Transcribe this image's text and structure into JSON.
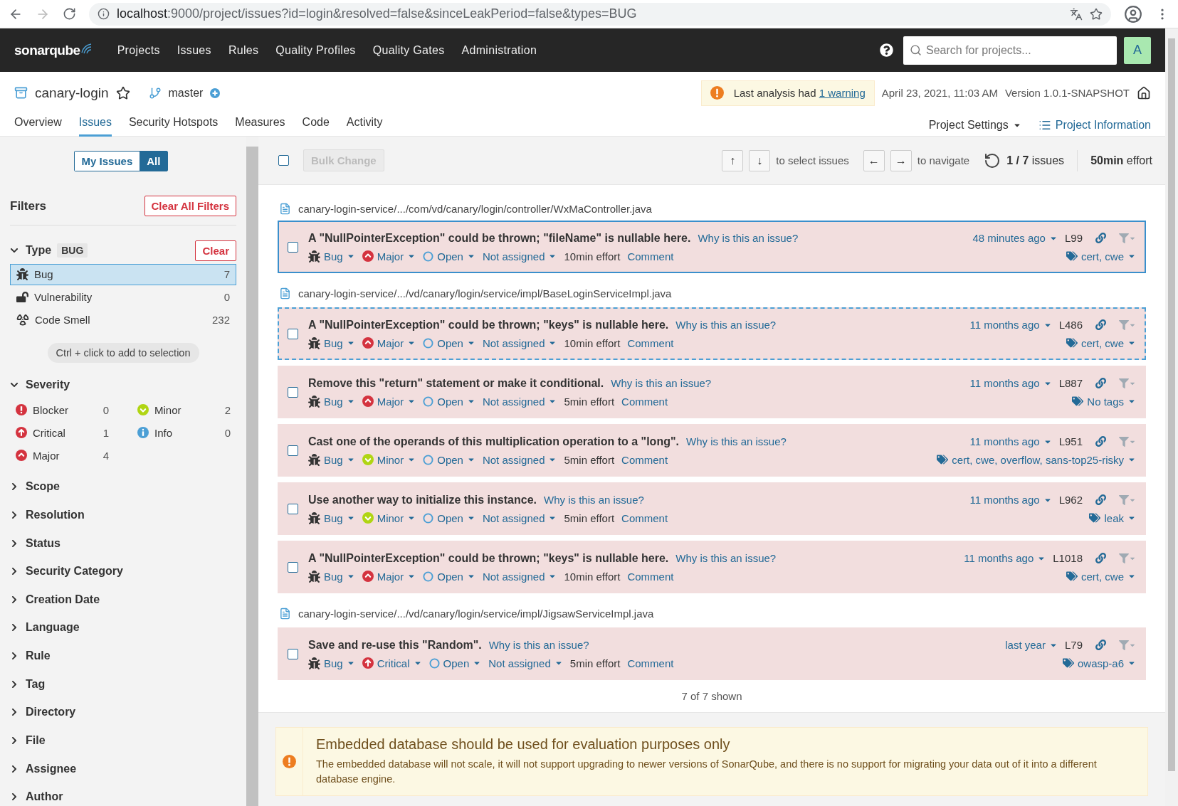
{
  "browser": {
    "host": "localhost",
    "path": ":9000/project/issues?id=login&resolved=false&sinceLeakPeriod=false&types=BUG"
  },
  "nav": {
    "logo": "sonarqube",
    "items": [
      "Projects",
      "Issues",
      "Rules",
      "Quality Profiles",
      "Quality Gates",
      "Administration"
    ],
    "search": {
      "placeholder": "Search for projects..."
    },
    "avatar": "A"
  },
  "project": {
    "name": "canary-login",
    "branch": "master",
    "warning": {
      "text": "Last analysis had ",
      "link": "1 warning"
    },
    "date": "April 23, 2021, 11:03 AM",
    "version": "Version 1.0.1-SNAPSHOT",
    "tabs": [
      {
        "label": "Overview",
        "selected": false
      },
      {
        "label": "Issues",
        "selected": true
      },
      {
        "label": "Security Hotspots",
        "selected": false
      },
      {
        "label": "Measures",
        "selected": false
      },
      {
        "label": "Code",
        "selected": false
      },
      {
        "label": "Activity",
        "selected": false
      }
    ],
    "settings": "Project Settings",
    "information": "Project Information"
  },
  "sidebar": {
    "toggle": [
      {
        "label": "My Issues",
        "selected": false
      },
      {
        "label": "All",
        "selected": true
      }
    ],
    "filters_title": "Filters",
    "clear_all": "Clear All Filters",
    "type_facet": {
      "title": "Type",
      "badge": "BUG",
      "clear": "Clear",
      "expanded": true,
      "hint": "Ctrl + click to add to selection",
      "items": [
        {
          "kind": "bug",
          "label": "Bug",
          "count": "7",
          "selected": true
        },
        {
          "kind": "vulnerability",
          "label": "Vulnerability",
          "count": "0",
          "selected": false
        },
        {
          "kind": "code_smell",
          "label": "Code Smell",
          "count": "232",
          "selected": false
        }
      ]
    },
    "severity_facet": {
      "title": "Severity",
      "expanded": true,
      "items": [
        {
          "kind": "blocker",
          "label": "Blocker",
          "count": "0"
        },
        {
          "kind": "minor",
          "label": "Minor",
          "count": "2"
        },
        {
          "kind": "critical",
          "label": "Critical",
          "count": "1"
        },
        {
          "kind": "info",
          "label": "Info",
          "count": "0"
        },
        {
          "kind": "major",
          "label": "Major",
          "count": "4"
        }
      ]
    },
    "facets": [
      {
        "title": "Scope",
        "expanded": false
      },
      {
        "title": "Resolution",
        "expanded": false
      },
      {
        "title": "Status",
        "expanded": false
      },
      {
        "title": "Security Category",
        "expanded": false
      },
      {
        "title": "Creation Date",
        "expanded": false
      },
      {
        "title": "Language",
        "expanded": false
      },
      {
        "title": "Rule",
        "expanded": false
      },
      {
        "title": "Tag",
        "expanded": false
      },
      {
        "title": "Directory",
        "expanded": false
      },
      {
        "title": "File",
        "expanded": false
      },
      {
        "title": "Assignee",
        "expanded": false
      },
      {
        "title": "Author",
        "expanded": false
      }
    ]
  },
  "toolbar": {
    "checked": false,
    "bulk_change": "Bulk Change",
    "select_keys": [
      "↑",
      "↓"
    ],
    "select_hint": "to select issues",
    "nav_keys": [
      "←",
      "→"
    ],
    "nav_hint": "to navigate",
    "count": "1 / 7",
    "count_unit": "issues",
    "effort": "50min",
    "effort_unit": "effort"
  },
  "groups": [
    {
      "file": "canary-login-service/.../com/vd/canary/login/controller/WxMaController.java",
      "issues": [
        {
          "message": "A \"NullPointerException\" could be thrown; \"fileName\" is nullable here.",
          "why": "Why is this an issue?",
          "type": "Bug",
          "severity": {
            "kind": "major",
            "label": "Major"
          },
          "status": "Open",
          "assignee": "Not assigned",
          "effort": "10min effort",
          "comment": "Comment",
          "age": "48 minutes ago",
          "line": "L99",
          "tags": "cert, cwe",
          "checked": false,
          "selected": true,
          "focused": false
        }
      ]
    },
    {
      "file": "canary-login-service/.../vd/canary/login/service/impl/BaseLoginServiceImpl.java",
      "issues": [
        {
          "message": "A \"NullPointerException\" could be thrown; \"keys\" is nullable here.",
          "why": "Why is this an issue?",
          "type": "Bug",
          "severity": {
            "kind": "major",
            "label": "Major"
          },
          "status": "Open",
          "assignee": "Not assigned",
          "effort": "10min effort",
          "comment": "Comment",
          "age": "11 months ago",
          "line": "L486",
          "tags": "cert, cwe",
          "checked": false,
          "selected": false,
          "focused": true
        },
        {
          "message": "Remove this \"return\" statement or make it conditional.",
          "why": "Why is this an issue?",
          "type": "Bug",
          "severity": {
            "kind": "major",
            "label": "Major"
          },
          "status": "Open",
          "assignee": "Not assigned",
          "effort": "5min effort",
          "comment": "Comment",
          "age": "11 months ago",
          "line": "L887",
          "tags": "No tags",
          "checked": false,
          "selected": false,
          "focused": false
        },
        {
          "message": "Cast one of the operands of this multiplication operation to a \"long\".",
          "why": "Why is this an issue?",
          "type": "Bug",
          "severity": {
            "kind": "minor",
            "label": "Minor"
          },
          "status": "Open",
          "assignee": "Not assigned",
          "effort": "5min effort",
          "comment": "Comment",
          "age": "11 months ago",
          "line": "L951",
          "tags": "cert, cwe, overflow, sans-top25-risky",
          "checked": false,
          "selected": false,
          "focused": false
        },
        {
          "message": "Use another way to initialize this instance.",
          "why": "Why is this an issue?",
          "type": "Bug",
          "severity": {
            "kind": "minor",
            "label": "Minor"
          },
          "status": "Open",
          "assignee": "Not assigned",
          "effort": "5min effort",
          "comment": "Comment",
          "age": "11 months ago",
          "line": "L962",
          "tags": "leak",
          "checked": false,
          "selected": false,
          "focused": false
        },
        {
          "message": "A \"NullPointerException\" could be thrown; \"keys\" is nullable here.",
          "why": "Why is this an issue?",
          "type": "Bug",
          "severity": {
            "kind": "major",
            "label": "Major"
          },
          "status": "Open",
          "assignee": "Not assigned",
          "effort": "10min effort",
          "comment": "Comment",
          "age": "11 months ago",
          "line": "L1018",
          "tags": "cert, cwe",
          "checked": false,
          "selected": false,
          "focused": false
        }
      ]
    },
    {
      "file": "canary-login-service/.../vd/canary/login/service/impl/JigsawServiceImpl.java",
      "issues": [
        {
          "message": "Save and re-use this \"Random\".",
          "why": "Why is this an issue?",
          "type": "Bug",
          "severity": {
            "kind": "critical",
            "label": "Critical"
          },
          "status": "Open",
          "assignee": "Not assigned",
          "effort": "5min effort",
          "comment": "Comment",
          "age": "last year",
          "line": "L79",
          "tags": "owasp-a6",
          "checked": false,
          "selected": false,
          "focused": false
        }
      ]
    }
  ],
  "shown": "7 of 7 shown",
  "notice": {
    "title": "Embedded database should be used for evaluation purposes only",
    "text": "The embedded database will not scale, it will not support upgrading to newer versions of SonarQube, and there is no support for migrating your data out of it into a different database engine."
  }
}
